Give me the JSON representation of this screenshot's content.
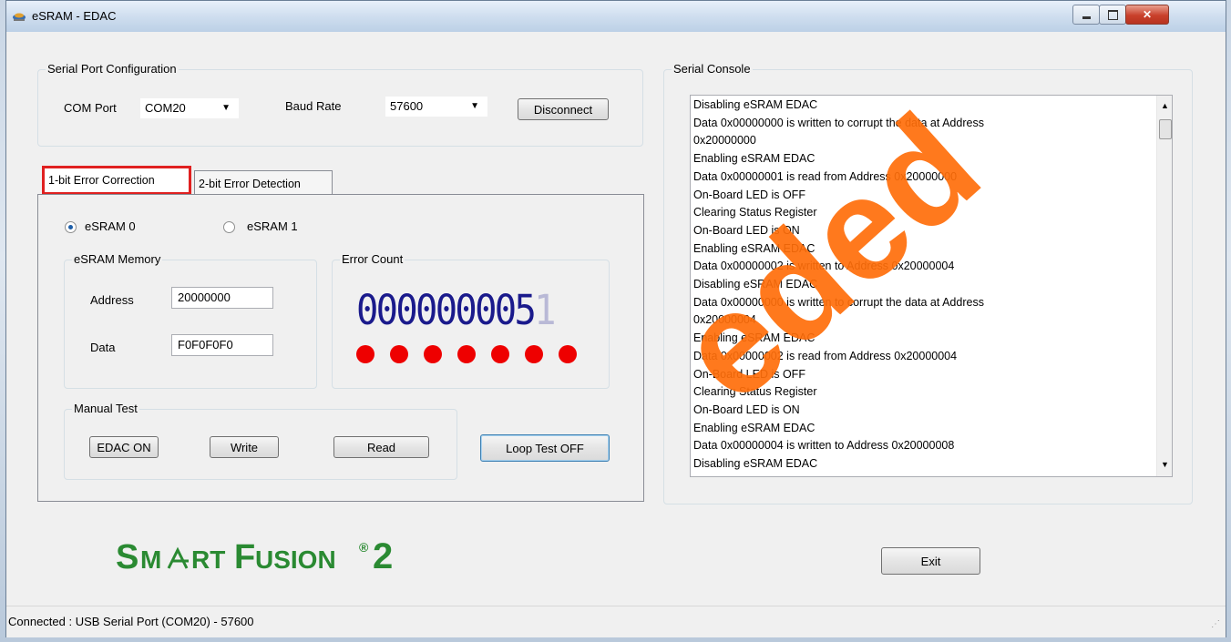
{
  "window": {
    "title": "eSRAM - EDAC",
    "caption_buttons": [
      "minimize-icon",
      "maximize-icon",
      "close-icon"
    ]
  },
  "serial_config": {
    "group_title": "Serial Port Configuration",
    "com_port_label": "COM Port",
    "com_port_value": "COM20",
    "baud_rate_label": "Baud Rate",
    "baud_rate_value": "57600",
    "disconnect_label": "Disconnect"
  },
  "tabs": [
    {
      "label": "1-bit Error Correction",
      "selected": true
    },
    {
      "label": "2-bit Error Detection",
      "selected": false
    }
  ],
  "memory_select": {
    "options": [
      {
        "label": "eSRAM 0",
        "selected": true
      },
      {
        "label": "eSRAM 1",
        "selected": false
      }
    ]
  },
  "esram_memory": {
    "group_title": "eSRAM Memory",
    "address_label": "Address",
    "address_value": "20000000",
    "data_label": "Data",
    "data_value": "F0F0F0F0"
  },
  "error_count": {
    "group_title": "Error Count",
    "digits": "000000005",
    "last_digit": "1",
    "led_count": 7,
    "led_color": "#ee0000"
  },
  "manual_test": {
    "group_title": "Manual Test",
    "edac_label": "EDAC ON",
    "write_label": "Write",
    "read_label": "Read"
  },
  "loop_test_label": "Loop Test OFF",
  "serial_console": {
    "group_title": "Serial Console",
    "lines": [
      "Disabling eSRAM EDAC",
      "Data 0x00000000 is written to corrupt the data at Address",
      "0x20000000",
      "Enabling eSRAM EDAC",
      "Data 0x00000001 is read from Address 0x20000000",
      "On-Board LED is OFF",
      "Clearing Status Register",
      "On-Board LED is ON",
      "Enabling eSRAM EDAC",
      "Data 0x00000002 is written to Address 0x20000004",
      "Disabling eSRAM EDAC",
      "Data 0x00000000 is written to corrupt the data at Address",
      "0x20000004",
      "Enabling eSRAM EDAC",
      "Data 0x00000002 is read from Address 0x20000004",
      "On-Board LED is OFF",
      "Clearing Status Register",
      "On-Board LED is ON",
      "Enabling eSRAM EDAC",
      "Data 0x00000004 is written to Address 0x20000008",
      "Disabling eSRAM EDAC"
    ]
  },
  "logo": {
    "brand": "SmartFusion",
    "superscript": "®",
    "version": "2",
    "color": "#2a8a32"
  },
  "exit_label": "Exit",
  "status_bar": "Connected : USB Serial Port (COM20) - 57600",
  "watermark": "Superseded",
  "highlight_color": "#e02020"
}
